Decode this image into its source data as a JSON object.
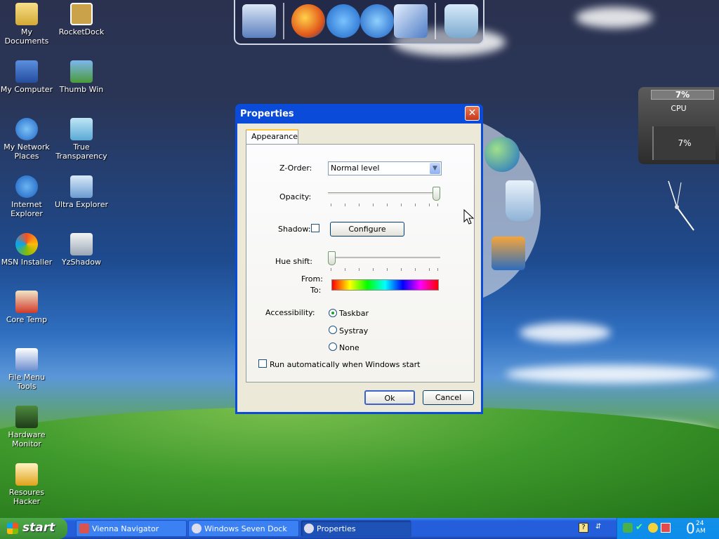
{
  "desktop": {
    "icons": [
      {
        "label": "My Documents"
      },
      {
        "label": "RocketDock"
      },
      {
        "label": "My Computer"
      },
      {
        "label": "Thumb Win"
      },
      {
        "label": "My Network Places"
      },
      {
        "label": "True Transparency"
      },
      {
        "label": "Internet Explorer"
      },
      {
        "label": "Ultra Explorer"
      },
      {
        "label": "MSN Installer"
      },
      {
        "label": "YzShadow"
      },
      {
        "label": "Core Temp"
      },
      {
        "label": "File Menu Tools"
      },
      {
        "label": "Hardware Monitor"
      },
      {
        "label": "Resoures Hacker"
      }
    ]
  },
  "cpu_widget": {
    "top_value": "7%",
    "label": "CPU",
    "bottom_value": "7%"
  },
  "dialog": {
    "title": "Properties",
    "close_label": "✕",
    "tab": "Appearance",
    "zorder_label": "Z-Order:",
    "zorder_value": "Normal level",
    "opacity_label": "Opacity:",
    "opacity_level": 1.0,
    "shadow_label": "Shadow:",
    "configure_label": "Configure",
    "hue_label": "Hue shift:",
    "hue_level": 0.0,
    "from_label": "From:",
    "to_label": "To:",
    "accessibility_label": "Accessibility:",
    "options": [
      "Taskbar",
      "Systray",
      "None"
    ],
    "selected_option": "Taskbar",
    "autorun_label": "Run automatically when Windows start",
    "ok_label": "Ok",
    "cancel_label": "Cancel"
  },
  "taskbar": {
    "start_label": "start",
    "tasks": [
      "Vienna Navigator",
      "Windows Seven Dock",
      "Properties"
    ],
    "clock": "0",
    "clock_small": "24 AM"
  }
}
